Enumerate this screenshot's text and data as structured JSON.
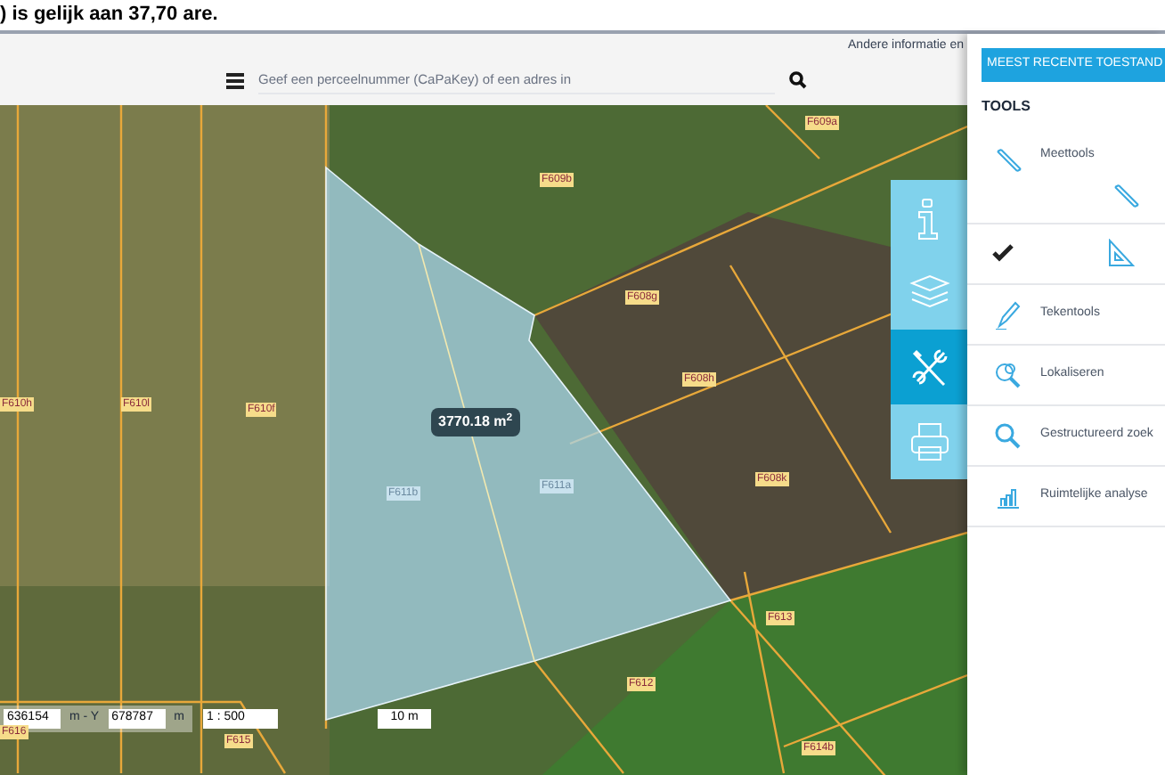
{
  "header": {
    "text": ") is gelijk aan 37,70 are."
  },
  "info_link": "Andere informatie en",
  "search": {
    "placeholder": "Geef een perceelnummer (CaPaKey) of een adres in"
  },
  "map": {
    "parcels": [
      {
        "label": "F609a"
      },
      {
        "label": "F609b"
      },
      {
        "label": "F608g"
      },
      {
        "label": "F608h"
      },
      {
        "label": "F610h"
      },
      {
        "label": "F610l"
      },
      {
        "label": "F610f"
      },
      {
        "label": "F611b"
      },
      {
        "label": "F611a"
      },
      {
        "label": "F608k"
      },
      {
        "label": "F613"
      },
      {
        "label": "F612"
      },
      {
        "label": "F616"
      },
      {
        "label": "F615"
      },
      {
        "label": "F614b"
      }
    ],
    "measurement": "3770.18 m$^{2}$",
    "x_value": "636154",
    "x_unit": "m - Y",
    "y_value": "678787",
    "y_unit": "m",
    "scale": "1 : 500",
    "scale_bar": "10 m"
  },
  "toolbar": [
    {
      "kind": "info",
      "selected": false
    },
    {
      "kind": "layers",
      "selected": false
    },
    {
      "kind": "tools",
      "selected": true
    },
    {
      "kind": "print",
      "selected": false
    }
  ],
  "panel": {
    "button": "MEEST RECENTE TOESTAND",
    "heading": "TOOLS",
    "tools": [
      {
        "kind": "measure",
        "label": "Meettools"
      },
      {
        "kind": "confirm"
      },
      {
        "kind": "draw",
        "label": "Tekentools"
      },
      {
        "kind": "locate",
        "label": "Lokaliseren"
      },
      {
        "kind": "search",
        "label": "Gestructureerd zoek"
      },
      {
        "kind": "analysis",
        "label": "Ruimtelijke analyse"
      }
    ]
  }
}
